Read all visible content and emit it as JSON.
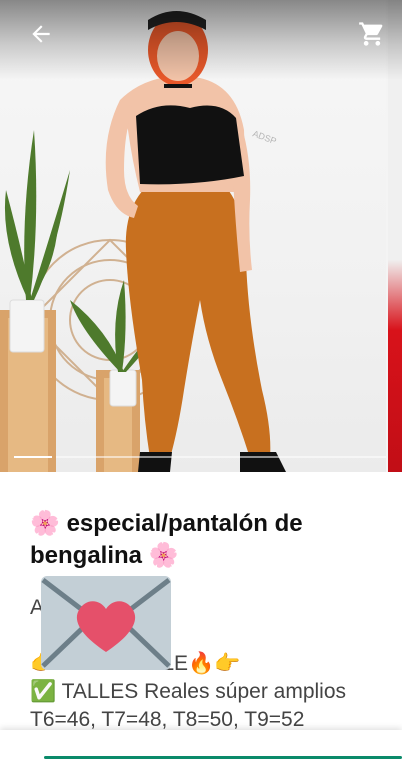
{
  "header": {
    "back_icon": "arrow-left-icon",
    "cart_icon": "shopping-cart-icon"
  },
  "product": {
    "title_prefix_emoji": "🌸",
    "title_text": "especial/pantalón de bengalina",
    "title_suffix_emoji": "🌸",
    "description_lines": [
      "A",
      "👉 DISPONIBLE🔥👉",
      "✅ TALLES Reales súper amplios",
      "T6=46,  T7=48, T8=50, T9=52"
    ],
    "sticker": "heart-envelope-sticker"
  },
  "colors": {
    "pants": "#c8701f",
    "top": "#111111",
    "hair": "#e8582a",
    "accent": "#0a8a6a"
  }
}
